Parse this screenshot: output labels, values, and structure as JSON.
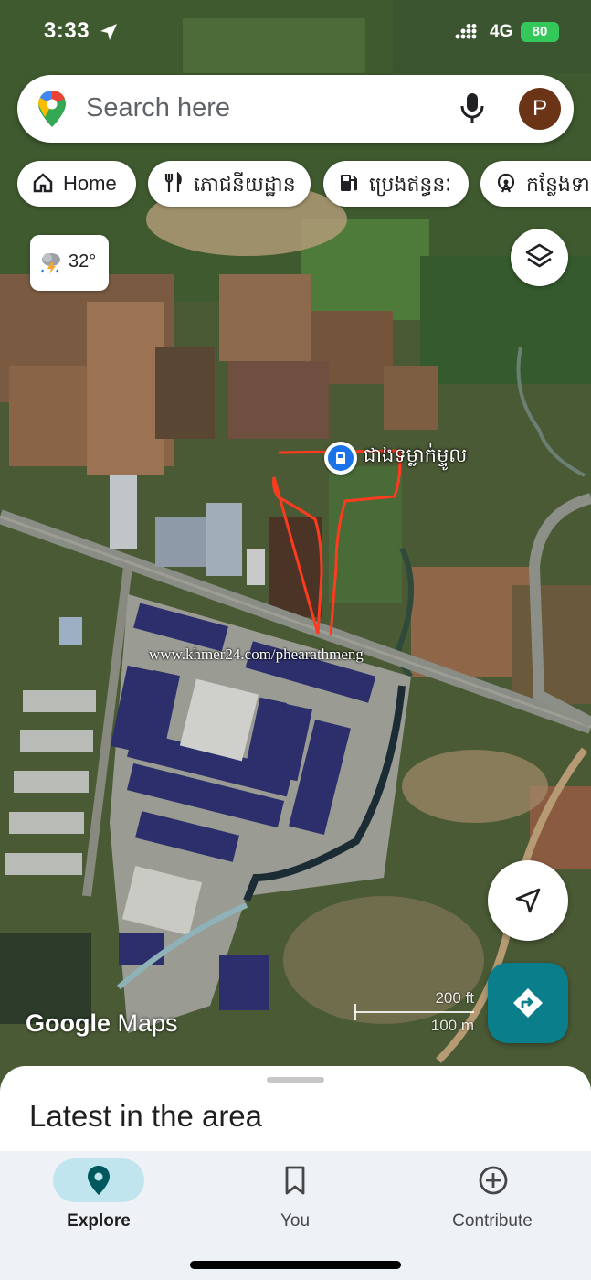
{
  "status_bar": {
    "time": "3:33",
    "network": "4G",
    "battery": "80"
  },
  "search": {
    "placeholder": "Search here",
    "avatar_initial": "P"
  },
  "chips": [
    {
      "label": "Home",
      "icon": "home-icon"
    },
    {
      "label": "ភោជនីយដ្ឋាន",
      "icon": "restaurant-icon"
    },
    {
      "label": "ប្រេងឥន្ធនៈ",
      "icon": "gas-station-icon"
    },
    {
      "label": "កន្លែងទាក់ទាញ",
      "icon": "attraction-icon"
    }
  ],
  "weather": {
    "temperature": "32°",
    "icon": "thunderstorm-icon"
  },
  "map": {
    "place_label": "ជាងទម្លាក់ម្ទូល",
    "watermark": "www.khmer24.com/phearathmeng",
    "logo_google": "Google",
    "logo_maps": "Maps",
    "scale_ft": "200 ft",
    "scale_m": "100 m"
  },
  "sheet": {
    "title": "Latest in the area"
  },
  "nav": {
    "items": [
      {
        "label": "Explore",
        "icon": "explore-pin-icon",
        "active": true
      },
      {
        "label": "You",
        "icon": "bookmark-icon",
        "active": false
      },
      {
        "label": "Contribute",
        "icon": "add-circle-icon",
        "active": false
      }
    ]
  },
  "colors": {
    "accent": "#0b7e8c",
    "explore_pill": "#c1e5ef",
    "avatar": "#6b3417",
    "battery": "#34c759",
    "boundary": "#ff3b1f"
  }
}
